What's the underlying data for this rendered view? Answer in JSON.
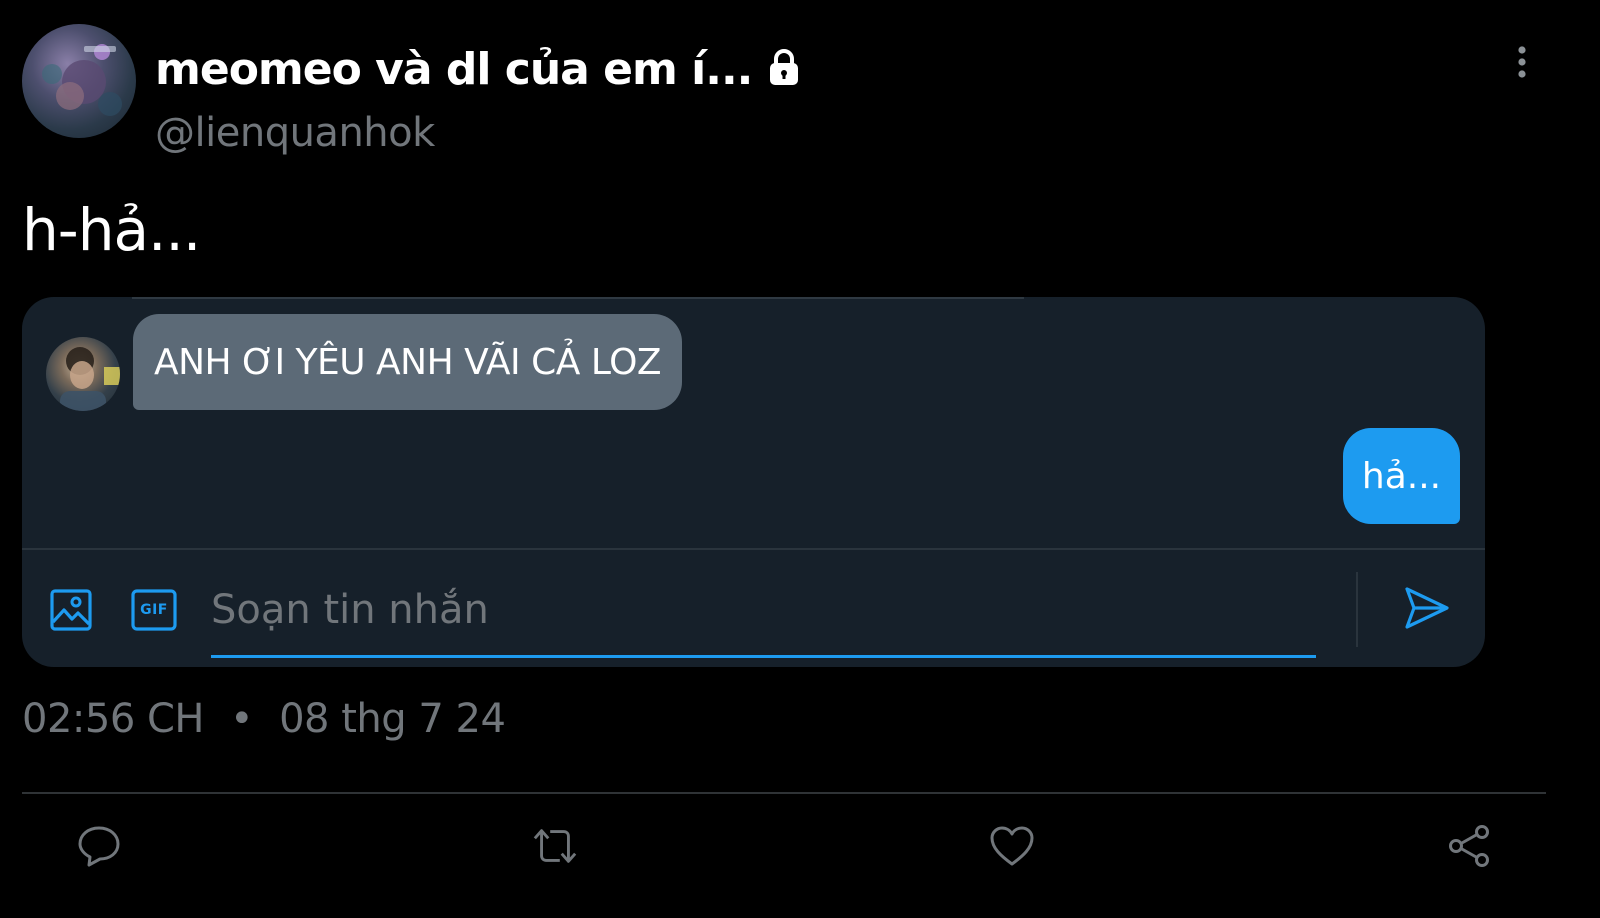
{
  "tweet": {
    "author": {
      "display_name": "meomeo và dl của em í...",
      "handle": "@lienquanhok",
      "protected_icon": "lock-icon"
    },
    "text": "h-hả...",
    "timestamp": {
      "time": "02:56 CH",
      "separator": "•",
      "date": "08 thg 7 24"
    }
  },
  "dm_preview": {
    "messages": [
      {
        "direction": "incoming",
        "text": "ANH ƠI YÊU ANH VÃI CẢ LOZ"
      },
      {
        "direction": "outgoing",
        "text": "hả..."
      }
    ],
    "composer": {
      "placeholder": "Soạn tin nhắn",
      "media_icon": "image-icon",
      "gif_label": "GIF",
      "send_icon": "send-icon"
    }
  },
  "actions": {
    "icons": [
      "reply-icon",
      "retweet-icon",
      "like-icon",
      "share-icon"
    ]
  },
  "colors": {
    "background": "#000000",
    "card": "#16202a",
    "accent": "#1d9bf0",
    "incoming_bubble": "#5c6a77",
    "secondary_text": "#71767b"
  }
}
